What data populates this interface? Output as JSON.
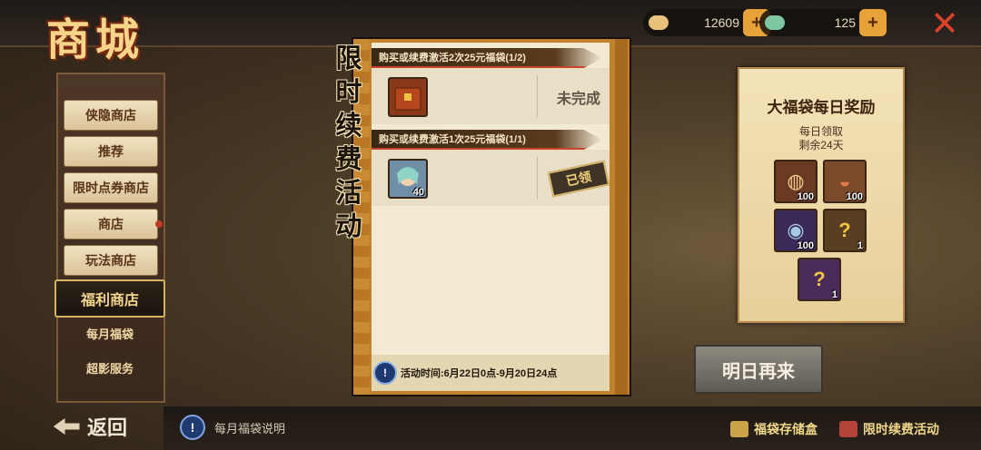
{
  "header": {
    "logo": "商城",
    "currencies": [
      {
        "icon": "coin-roll-icon",
        "value": "12609",
        "color": "#e8c27a"
      },
      {
        "icon": "jade-icon",
        "value": "125",
        "color": "#7fc6a2"
      }
    ]
  },
  "sidebar": {
    "items": [
      {
        "label": "侠隐商店"
      },
      {
        "label": "推荐"
      },
      {
        "label": "限时点券商店"
      },
      {
        "label": "商店"
      },
      {
        "label": "玩法商店"
      },
      {
        "label": "福利商店"
      },
      {
        "label": "每月福袋"
      },
      {
        "label": "超影服务"
      }
    ],
    "back_label": "返回"
  },
  "popup": {
    "vertical_title": [
      "限",
      "时",
      "续",
      "费",
      "活",
      "动"
    ],
    "tasks": [
      {
        "title": "购买或续费激活2次25元福袋(1/2)",
        "status": "未完成",
        "icon": "red-bag-icon",
        "qty": ""
      },
      {
        "title": "购买或续费激活1次25元福袋(1/1)",
        "status": "已领",
        "icon": "ninja-portrait-icon",
        "qty": "40"
      }
    ],
    "footer": "活动时间:6月22日0点-9月20日24点"
  },
  "reward_panel": {
    "title": "大福袋每日奖励",
    "line1": "每日领取",
    "line2": "剩余24天",
    "items": [
      {
        "icon": "ramen-scroll-icon",
        "qty": "100"
      },
      {
        "icon": "ramen-bowl-icon",
        "qty": "100"
      },
      {
        "icon": "eye-orb-icon",
        "qty": "100"
      },
      {
        "icon": "mystery-box-icon",
        "qty": "1"
      },
      {
        "icon": "mystery-box-purple-icon",
        "qty": "1"
      }
    ],
    "button": "明日再来"
  },
  "bottom": {
    "info_label": "每月福袋说明",
    "links": [
      {
        "label": "福袋存储盒"
      },
      {
        "label": "限时续费活动"
      }
    ]
  },
  "colors": {
    "accent": "#e7a23a",
    "status_done": "#f2d27a",
    "close": "#d9412a"
  }
}
